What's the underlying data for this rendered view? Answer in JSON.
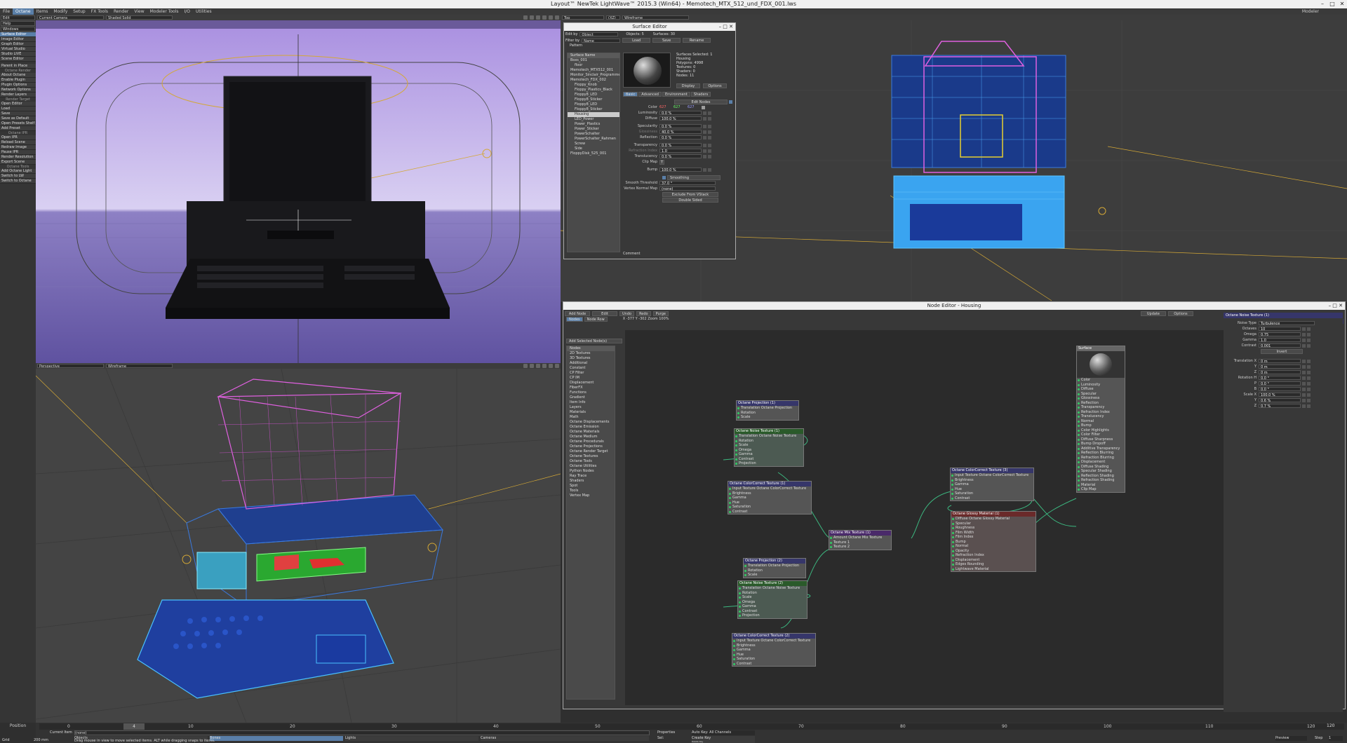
{
  "window": {
    "title": "Layout™ NewTek LightWave™ 2015.3 (Win64) - Memotech_MTX_512_und_FDX_001.lws",
    "controls": [
      "–",
      "□",
      "✕"
    ]
  },
  "menubar": {
    "items": [
      "File",
      "Octane",
      "Items",
      "Modify",
      "Setup",
      "FX Tools",
      "Render",
      "View",
      "Modeler Tools",
      "I/O",
      "Utilities"
    ],
    "active": 1,
    "right": "Modeler"
  },
  "sidebar": {
    "top": [
      "Edit",
      "Help"
    ],
    "windows_dd": "Windows",
    "group1": [
      "Surface Editor",
      "Image Editor",
      "Graph Editor",
      "Virtual Studio",
      "Studio LIVE",
      "Scene Editor"
    ],
    "parent": "Parent in Place",
    "h_octane_render": "Octane Render",
    "group2": [
      "About Octane",
      "Enable Plugin",
      "Plugin Options",
      "Network Options",
      "Render Layers"
    ],
    "h_render_target": "Render Target",
    "group3": [
      "Open Editor",
      "Load",
      "Save",
      "Save as Default",
      "Open Presets Shelf",
      "Add Preset"
    ],
    "h_ipr": "Octane IPR",
    "group4": [
      "Open IPR",
      "Reload Scene",
      "Redraw Image",
      "Pause IPR",
      "Render Resolution",
      "Export Scene"
    ],
    "h_tools": "Octane Tools",
    "group5": [
      "Add Octane Light",
      "Switch to LW",
      "Switch to Octane"
    ],
    "position": "Position"
  },
  "vp1": {
    "view": "Current Camera",
    "mode": "Shaded Solid"
  },
  "vp2": {
    "view": "Top",
    "axis": "(XZ)",
    "mode": "Wireframe"
  },
  "vp3": {
    "view": "Perspective",
    "mode": "Wireframe"
  },
  "surface_editor": {
    "title": "Surface Editor",
    "edit_by_label": "Edit by",
    "edit_by": "Object",
    "objects": "Objects: 5",
    "surfaces": "Surfaces: 30",
    "filter_label": "Filter by",
    "filter": "Name",
    "buttons": [
      "Load",
      "Save",
      "Rename"
    ],
    "pattern": "Pattern",
    "tree_header": "Surface Name",
    "tree": [
      "Boxs_001",
      "floor",
      "Memotech_MTX512_001",
      "Monitor_Sinclair_Programmer",
      "Memotech_FDX_002",
      "Floppy_Knob",
      "Floppy_Plastics_Black",
      "Floppy8_LED",
      "Floppy8_Sticker",
      "Floppy8_LED",
      "Floppy8_Sticker",
      "Housing",
      "LED_Power",
      "Power_Plastics",
      "Power_Sticker",
      "PowerSchalter",
      "PowerSchalter_Rahmen",
      "Screw",
      "Side",
      "FloppyDisk_525_001"
    ],
    "tree_sel": 11,
    "info": [
      "Surfaces Selected: 1",
      "Housing",
      "Polygons: 4998",
      "Textures: 0",
      "Shaders: 0",
      "Nodes: 11"
    ],
    "display": "Display",
    "options": "Options",
    "tabs": [
      "Basic",
      "Advanced",
      "Environment",
      "Shaders"
    ],
    "edit_nodes": "Edit Nodes",
    "color_label": "Color",
    "color_r": "627",
    "color_g": "627",
    "color_b": "627",
    "rows": [
      {
        "l": "Luminosity",
        "v": "0.0 %"
      },
      {
        "l": "Diffuse",
        "v": "100.0 %"
      },
      {
        "l": "Specularity",
        "v": "0.0 %"
      },
      {
        "l": "Glossiness",
        "v": "40.0 %"
      },
      {
        "l": "Reflection",
        "v": "0.0 %"
      },
      {
        "l": "Transparency",
        "v": "0.0 %"
      },
      {
        "l": "Refraction Index",
        "v": "1.0"
      },
      {
        "l": "Translucency",
        "v": "0.0 %"
      },
      {
        "l": "Clip Map",
        "v": "T"
      },
      {
        "l": "Bump",
        "v": "100.0 %"
      }
    ],
    "smoothing": "Smoothing",
    "smooth_label": "Smooth Threshold",
    "smooth_val": "37.0 °",
    "vnm_label": "Vertex Normal Map",
    "vnm_val": "(none)",
    "exclude": "Exclude From VStack",
    "double": "Double Sided",
    "comment": "Comment"
  },
  "node_editor": {
    "title": "Node Editor - Housing",
    "toolbar": [
      "Add Node",
      "Edit",
      "Undo",
      "Redo",
      "Purge"
    ],
    "update": "Update",
    "options": "Options",
    "tabs": [
      "Nodes",
      "Node Row"
    ],
    "coords": "X -377 Y -302 Zoom 100%",
    "add_selected": "Add Selected Node(s)",
    "list_header": "Nodes",
    "list": [
      "2D Textures",
      "3D Textures",
      "Additional",
      "Constant",
      "CP Filter",
      "CP IM",
      "Displacement",
      "FiberFX",
      "Functions",
      "Gradient",
      "Item Info",
      "Layers",
      "Materials",
      "Math",
      "Octane Displacements",
      "Octane Emission",
      "Octane Materials",
      "Octane Medium",
      "Octane Procedurals",
      "Octane Projections",
      "Octane Render Target",
      "Octane Textures",
      "Octane Tools",
      "Octane Utilities",
      "Python Nodes",
      "Ray Trace",
      "Shaders",
      "Spot",
      "Tools",
      "Vertex Map"
    ],
    "nodes": {
      "proj1": {
        "title": "Octane Projection (1)",
        "rows": [
          "Translation   Octane Projection",
          "Rotation",
          "Scale"
        ]
      },
      "noise1": {
        "title": "Octane Noise Texture (1)",
        "rows": [
          "Translation   Octane Noise Texture",
          "Rotation",
          "Scale",
          "Omega",
          "Gamma",
          "Contrast",
          "Projection"
        ]
      },
      "cc1": {
        "title": "Octane ColorCorrect Texture (1)",
        "rows": [
          "Input Texture   Octane ColorCorrect Texture",
          "Brightness",
          "Gamma",
          "Hue",
          "Saturation",
          "Contrast"
        ]
      },
      "proj2": {
        "title": "Octane Projection (2)",
        "rows": [
          "Translation   Octane Projection",
          "Rotation",
          "Scale"
        ]
      },
      "noise2": {
        "title": "Octane Noise Texture (2)",
        "rows": [
          "Translation   Octane Noise Texture",
          "Rotation",
          "Scale",
          "Omega",
          "Gamma",
          "Contrast",
          "Projection"
        ]
      },
      "cc2": {
        "title": "Octane ColorCorrect Texture (2)",
        "rows": [
          "Input Texture   Octane ColorCorrect Texture",
          "Brightness",
          "Gamma",
          "Hue",
          "Saturation",
          "Contrast"
        ]
      },
      "mix1": {
        "title": "Octane Mix Texture (1)",
        "rows": [
          "Amount   Octane Mix Texture",
          "Texture 1",
          "Texture 2"
        ]
      },
      "cc3": {
        "title": "Octane ColorCorrect Texture (3)",
        "rows": [
          "Input Texture   Octane ColorCorrect Texture",
          "Brightness",
          "Gamma",
          "Hue",
          "Saturation",
          "Contrast"
        ]
      },
      "glossy1": {
        "title": "Octane Glossy Material (1)",
        "rows": [
          "Diffuse   Octane Glossy Material",
          "Specular",
          "Roughness",
          "Film Width",
          "Film Index",
          "Bump",
          "Normal",
          "Opacity",
          "Refraction Index",
          "Displacement",
          "Edges Rounding",
          "Lightwave Material"
        ]
      },
      "surface": {
        "title": "Surface",
        "rows": [
          "Color",
          "Luminosity",
          "Diffuse",
          "Specular",
          "Glossiness",
          "Reflection",
          "Transparency",
          "Refraction Index",
          "Translucency",
          "Normal",
          "Bump",
          "Color Highlights",
          "Color Filter",
          "Diffuse Sharpness",
          "Bump Dropoff",
          "Additive Transparency",
          "Reflection Blurring",
          "Refraction Blurring",
          "Displacement",
          "Diffuse Shading",
          "Specular Shading",
          "Reflection Shading",
          "Refraction Shading",
          "Material",
          "Clip Map"
        ]
      }
    },
    "props_title": "Octane Noise Texture (1)",
    "props": [
      {
        "l": "Noise Type",
        "v": "Turbulence"
      },
      {
        "l": "Octaves",
        "v": "10"
      },
      {
        "l": "Omega",
        "v": "0.75"
      },
      {
        "l": "Gamma",
        "v": "1.0"
      },
      {
        "l": "Contrast",
        "v": "0.001"
      }
    ],
    "invert": "Invert",
    "props2": [
      {
        "l": "Translation X",
        "v": "0 m"
      },
      {
        "l": "Y",
        "v": "0 m"
      },
      {
        "l": "Z",
        "v": "0 m"
      },
      {
        "l": "Rotation H",
        "v": "0.0 °"
      },
      {
        "l": "P",
        "v": "0.0 °"
      },
      {
        "l": "B",
        "v": "0.0 °"
      },
      {
        "l": "Scale X",
        "v": "100.0 %"
      },
      {
        "l": "Y",
        "v": "0.6 %"
      },
      {
        "l": "Z",
        "v": "0.7 %"
      }
    ]
  },
  "timeline": {
    "ticks": [
      "0",
      "10",
      "20",
      "30",
      "40",
      "50",
      "60",
      "70",
      "80",
      "90",
      "100",
      "110",
      "120"
    ],
    "frame_start": "0",
    "frame_cur": "4",
    "end": "120",
    "current_item_label": "Current Item",
    "current_item": "(none)",
    "objects": "Objects",
    "bones": "Bones",
    "lights": "Lights",
    "cameras": "Cameras",
    "properties": "Properties",
    "sel": "Sel:",
    "autokey": "Auto Key: All Channels",
    "create_key": "Create Key",
    "delete_key": "Delete Key",
    "status": "Drag mouse in view to move selected items. ALT while dragging snaps to items.",
    "grid": "Grid",
    "grid_val": "200 mm",
    "preview": "Preview",
    "step": "Step",
    "step_val": "1"
  }
}
